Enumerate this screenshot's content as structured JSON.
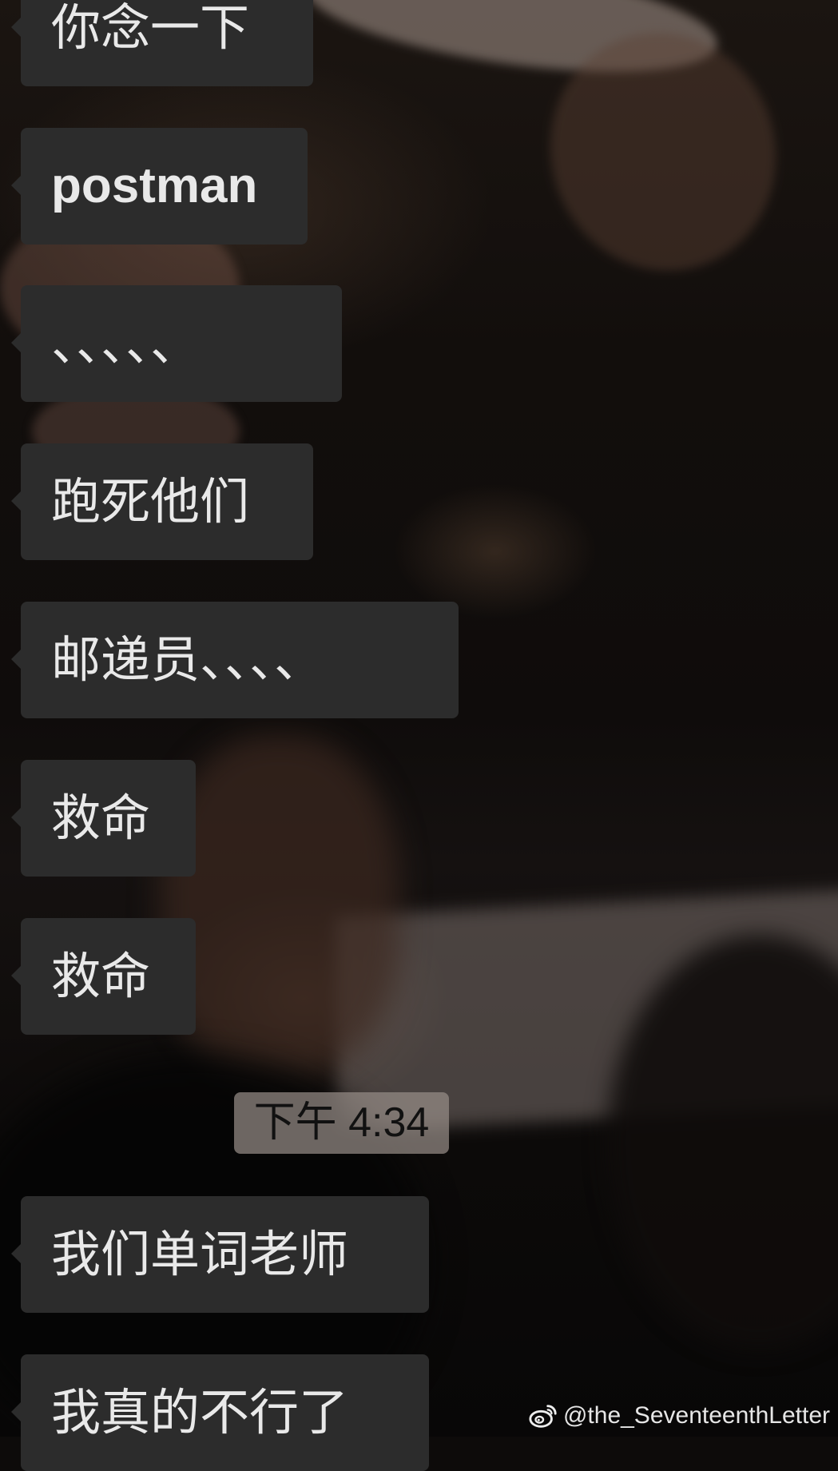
{
  "messages": [
    {
      "text": "你念一下"
    },
    {
      "text": "postman"
    },
    {
      "text": "、、、、、"
    },
    {
      "text": "跑死他们"
    },
    {
      "text": "邮递员、、、、"
    },
    {
      "text": "救命"
    },
    {
      "text": "救命"
    },
    {
      "text": "我们单词老师"
    },
    {
      "text": "我真的不行了"
    }
  ],
  "timestamp": "下午 4:34",
  "watermark": {
    "handle": "@the_SeventeenthLetter",
    "icon": "weibo-icon"
  },
  "colors": {
    "bubble": "#2c2c2c",
    "bubble_text": "#e9e9e9",
    "timestamp_bg": "#968c87",
    "timestamp_text": "#111111"
  }
}
